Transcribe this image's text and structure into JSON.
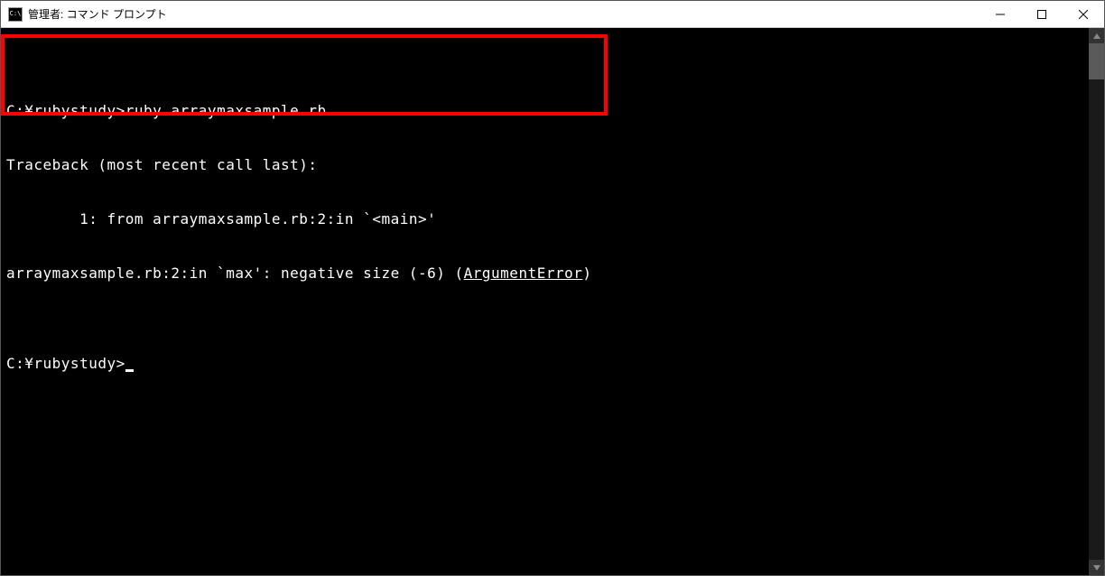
{
  "window": {
    "title": "管理者: コマンド プロンプト",
    "icon_text": "C:\\"
  },
  "terminal": {
    "blank_line": "",
    "line1_prefix": "C:¥rubystudy>",
    "line1_command": "ruby arraymaxsample.rb",
    "line2": "Traceback (most recent call last):",
    "line3": "        1: from arraymaxsample.rb:2:in `<main>'",
    "line4_prefix": "arraymaxsample.rb:2:in `max': negative size (-6) (",
    "line4_error": "ArgumentError",
    "line4_suffix": ")",
    "line5": "",
    "line6": "C:¥rubystudy>"
  }
}
